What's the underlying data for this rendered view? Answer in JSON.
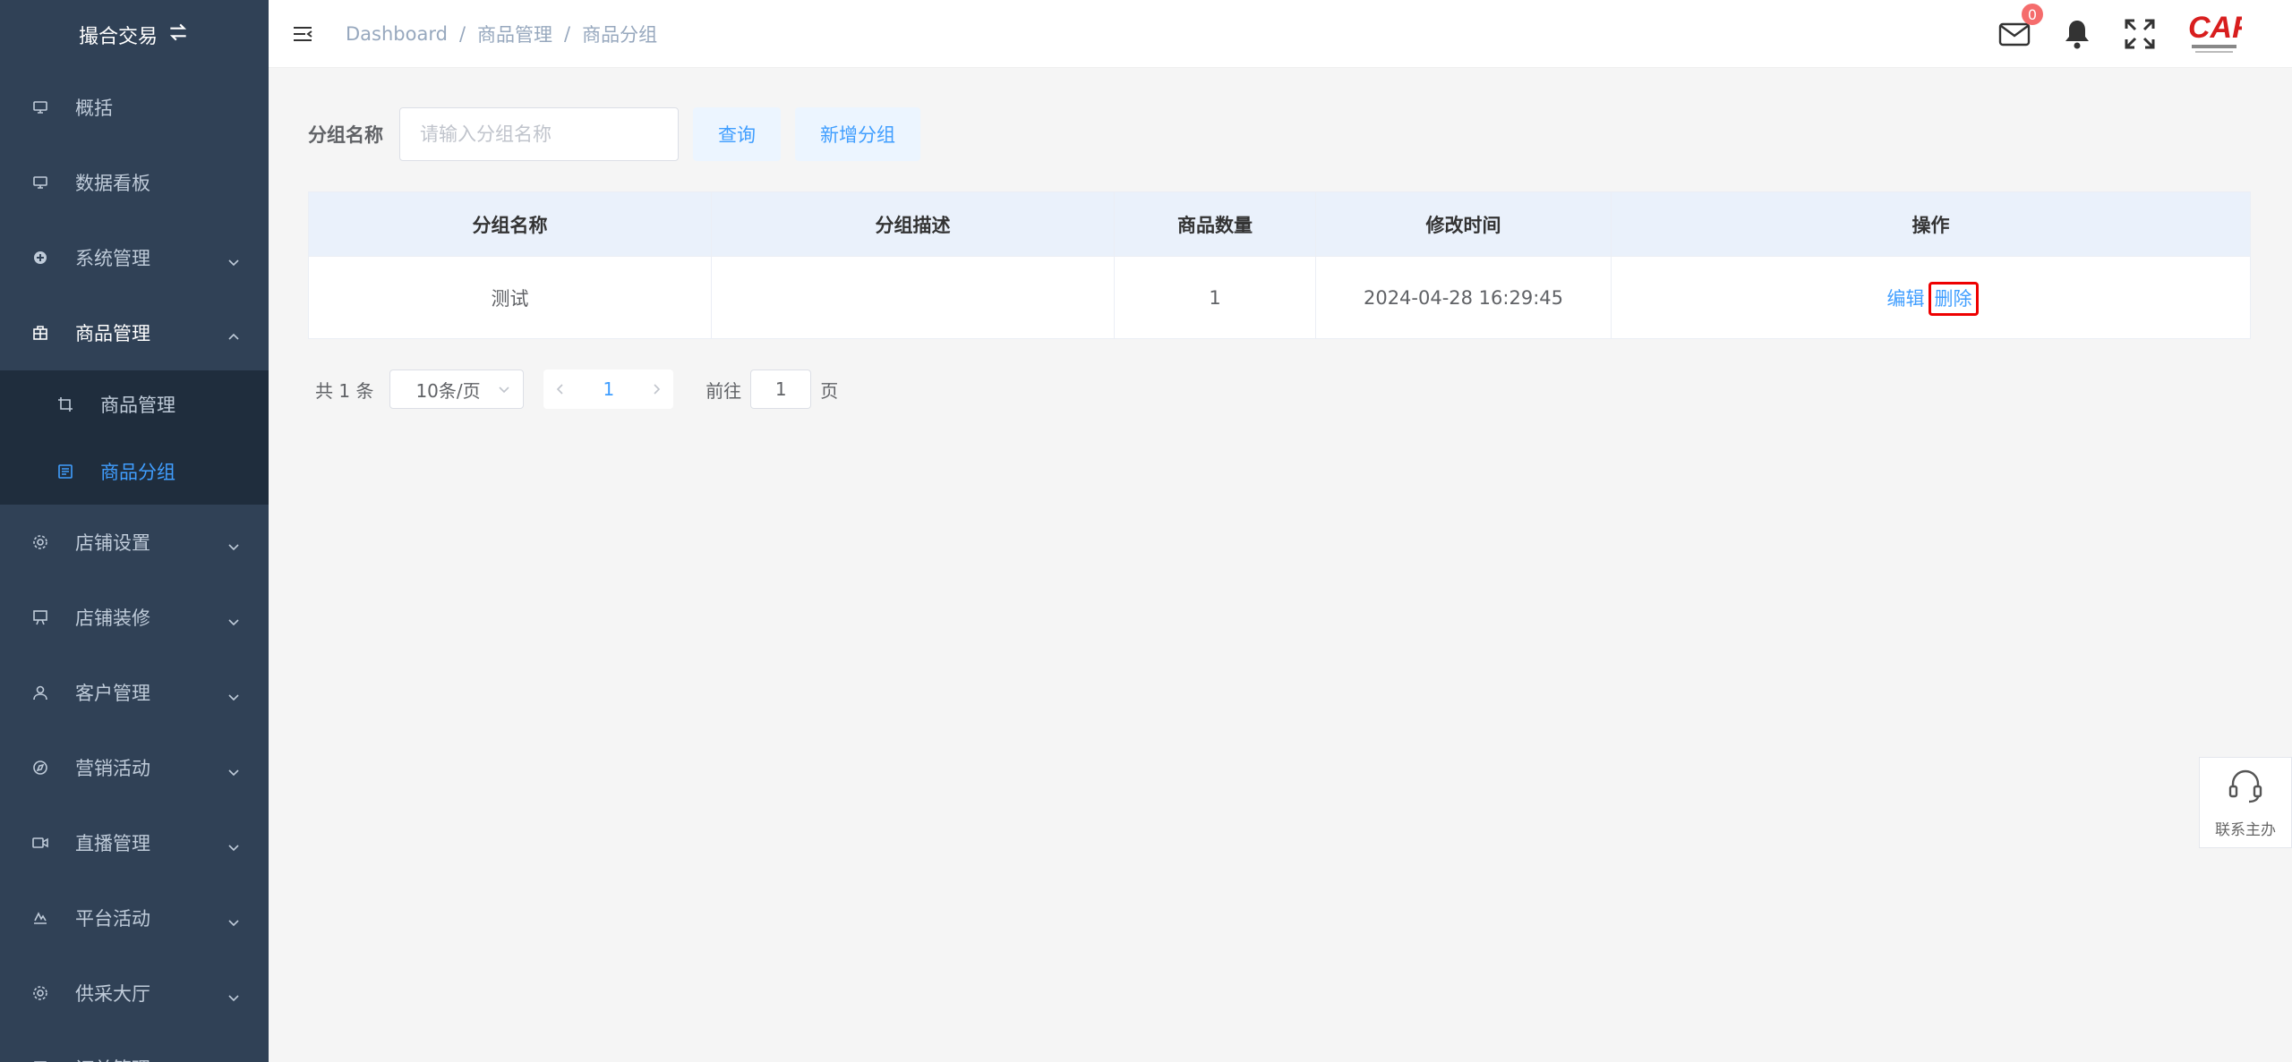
{
  "sidebar": {
    "brand": "撮合交易",
    "items": [
      {
        "label": "概括",
        "icon": "monitor-icon"
      },
      {
        "label": "数据看板",
        "icon": "monitor-icon"
      },
      {
        "label": "系统管理",
        "icon": "plus-circle-icon"
      },
      {
        "label": "商品管理",
        "icon": "grid-icon"
      },
      {
        "label": "店铺设置",
        "icon": "gear-icon"
      },
      {
        "label": "店铺装修",
        "icon": "easel-icon"
      },
      {
        "label": "客户管理",
        "icon": "user-icon"
      },
      {
        "label": "营销活动",
        "icon": "compass-icon"
      },
      {
        "label": "直播管理",
        "icon": "video-icon"
      },
      {
        "label": "平台活动",
        "icon": "sign-icon"
      },
      {
        "label": "供采大厅",
        "icon": "gear-icon"
      },
      {
        "label": "订单管理",
        "icon": "document-icon"
      }
    ],
    "submenu": [
      {
        "label": "商品管理",
        "icon": "crop-icon"
      },
      {
        "label": "商品分组",
        "icon": "list-icon"
      }
    ]
  },
  "navbar": {
    "breadcrumb": [
      "Dashboard",
      "商品管理",
      "商品分组"
    ],
    "mail_badge": "0"
  },
  "search": {
    "label": "分组名称",
    "placeholder": "请输入分组名称",
    "query_button": "查询",
    "add_button": "新增分组"
  },
  "table": {
    "headers": [
      "分组名称",
      "分组描述",
      "商品数量",
      "修改时间",
      "操作"
    ],
    "rows": [
      {
        "name": "测试",
        "desc": "",
        "count": "1",
        "time": "2024-04-28 16:29:45",
        "edit": "编辑",
        "delete": "删除"
      }
    ]
  },
  "pagination": {
    "total": "共 1 条",
    "page_size": "10条/页",
    "current": "1",
    "goto_label": "前往",
    "goto_value": "1",
    "page_suffix": "页"
  },
  "contact": {
    "label": "联系主办"
  },
  "colors": {
    "sidebar": "#304156",
    "accent": "#409eff",
    "badge": "#f56c6c",
    "highlight": "#e00000"
  }
}
